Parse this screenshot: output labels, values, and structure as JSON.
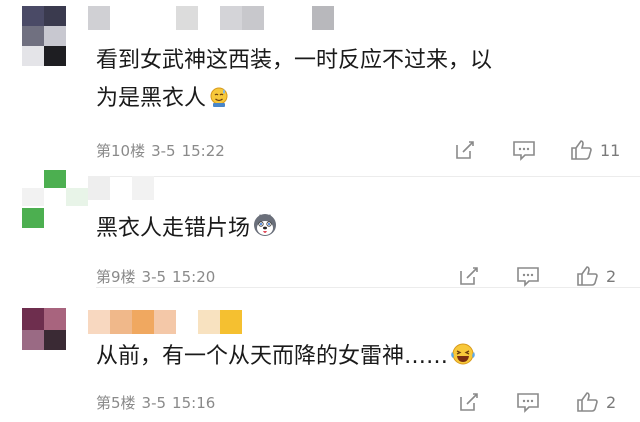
{
  "comments": [
    {
      "text_line1": "看到女武神这西装，一时反应不过来，以",
      "text_line2": "为是黑衣人",
      "emoji": "sweat-smile-emoji",
      "floor": "第10楼",
      "date": "3-5",
      "time": "15:22",
      "likes": "11"
    },
    {
      "text_line1": "黑衣人走错片场",
      "emoji": "husky-emoji",
      "floor": "第9楼",
      "date": "3-5",
      "time": "15:20",
      "likes": "2"
    },
    {
      "text_line1": "从前，有一个从天而降的女雷神……",
      "emoji": "laugh-tears-emoji",
      "floor": "第5楼",
      "date": "3-5",
      "time": "15:16",
      "likes": "2"
    }
  ],
  "icons": {
    "reply": "edit-icon",
    "comment": "comment-icon",
    "like": "thumbs-up-icon"
  },
  "colors": {
    "text": "#1a1a1a",
    "meta": "#8a8a8a",
    "icon": "#8a8a8a",
    "avatar_green": "#4caf50",
    "name_orange": "#f0a860",
    "name_yellow": "#f5c030"
  }
}
